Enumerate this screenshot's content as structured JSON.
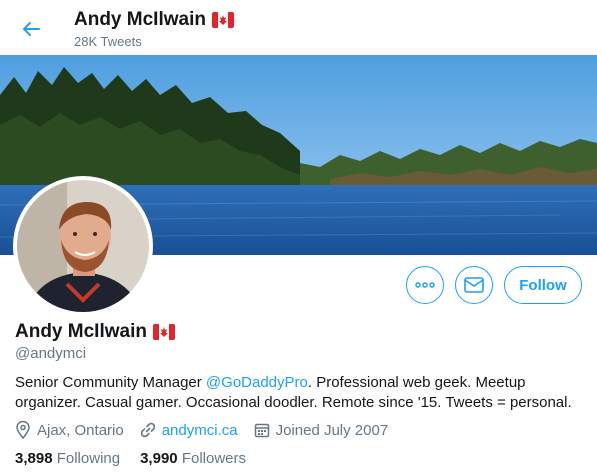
{
  "header": {
    "name": "Andy McIlwain",
    "tweet_count": "28K Tweets"
  },
  "profile": {
    "name": "Andy McIlwain",
    "handle": "@andymci",
    "bio_prefix": "Senior Community Manager ",
    "bio_mention": "@GoDaddyPro",
    "bio_suffix": ". Professional web geek. Meetup organizer. Casual gamer. Occasional doodler. Remote since '15. Tweets = personal.",
    "location": "Ajax, Ontario",
    "website": "andymci.ca",
    "joined": "Joined July 2007"
  },
  "actions": {
    "follow_label": "Follow"
  },
  "stats": {
    "following_count": "3,898",
    "following_label": "Following",
    "followers_count": "3,990",
    "followers_label": "Followers"
  },
  "icons": {
    "back": "arrow-left-icon",
    "more": "more-dots-icon",
    "message": "envelope-icon",
    "location": "location-pin-icon",
    "link": "link-icon",
    "calendar": "calendar-icon",
    "flag": "canada-flag-icon"
  },
  "colors": {
    "accent": "#1da1f2",
    "secondary_text": "#657786",
    "primary_text": "#14171a"
  }
}
